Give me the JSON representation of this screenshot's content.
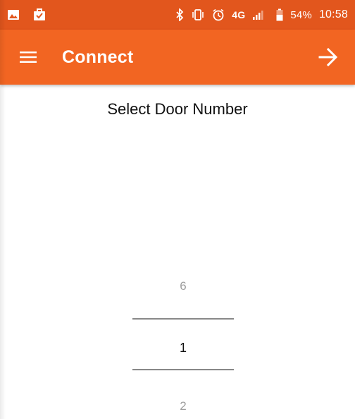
{
  "status_bar": {
    "left_icons": [
      "gallery-icon",
      "briefcase-check-icon"
    ],
    "right_icons": [
      "bluetooth-icon",
      "vibrate-icon",
      "alarm-icon",
      "lte-icon",
      "signal-icon",
      "battery-icon"
    ],
    "network_label": "4G",
    "battery_percent": "54%",
    "time": "10:58"
  },
  "app_bar": {
    "title": "Connect",
    "menu_icon": "hamburger-menu-icon",
    "next_icon": "arrow-right-icon"
  },
  "main": {
    "prompt": "Select Door Number",
    "picker": {
      "previous_value": "6",
      "selected_value": "1",
      "next_value": "2"
    }
  },
  "colors": {
    "status_bar": "#e2561d",
    "app_bar": "#f26522",
    "text_primary": "#111111",
    "text_muted": "#9e9e9e",
    "divider": "#888888"
  }
}
